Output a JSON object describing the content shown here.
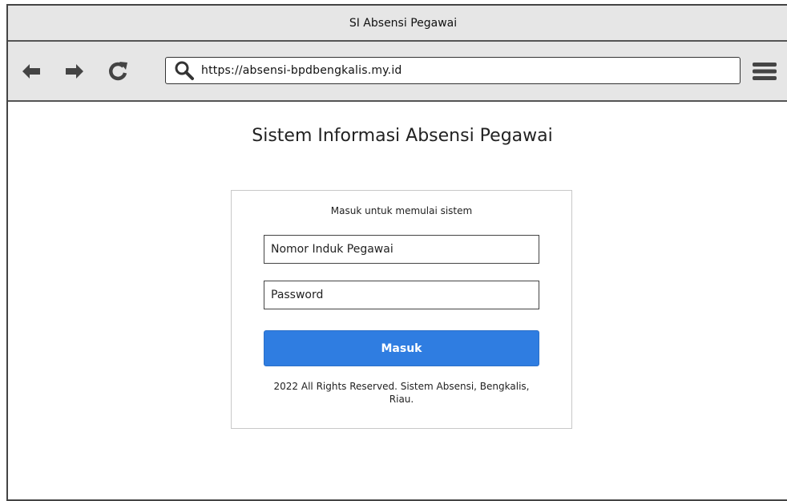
{
  "window": {
    "title": "SI Absensi Pegawai"
  },
  "toolbar": {
    "url": "https://absensi-bpdbengkalis.my.id",
    "icons": [
      "back-arrow-icon",
      "forward-arrow-icon",
      "reload-icon",
      "search-icon",
      "hamburger-menu-icon"
    ]
  },
  "page": {
    "title": "Sistem Informasi Absensi Pegawai"
  },
  "login": {
    "subtitle": "Masuk untuk memulai sistem",
    "nip_placeholder": "Nomor Induk Pegawai",
    "password_placeholder": "Password",
    "submit_label": "Masuk",
    "footer": "2022 All Rights Reserved. Sistem Absensi, Bengkalis, Riau."
  },
  "colors": {
    "primary_button": "#2f7de1",
    "chrome_background": "#e6e6e6"
  }
}
